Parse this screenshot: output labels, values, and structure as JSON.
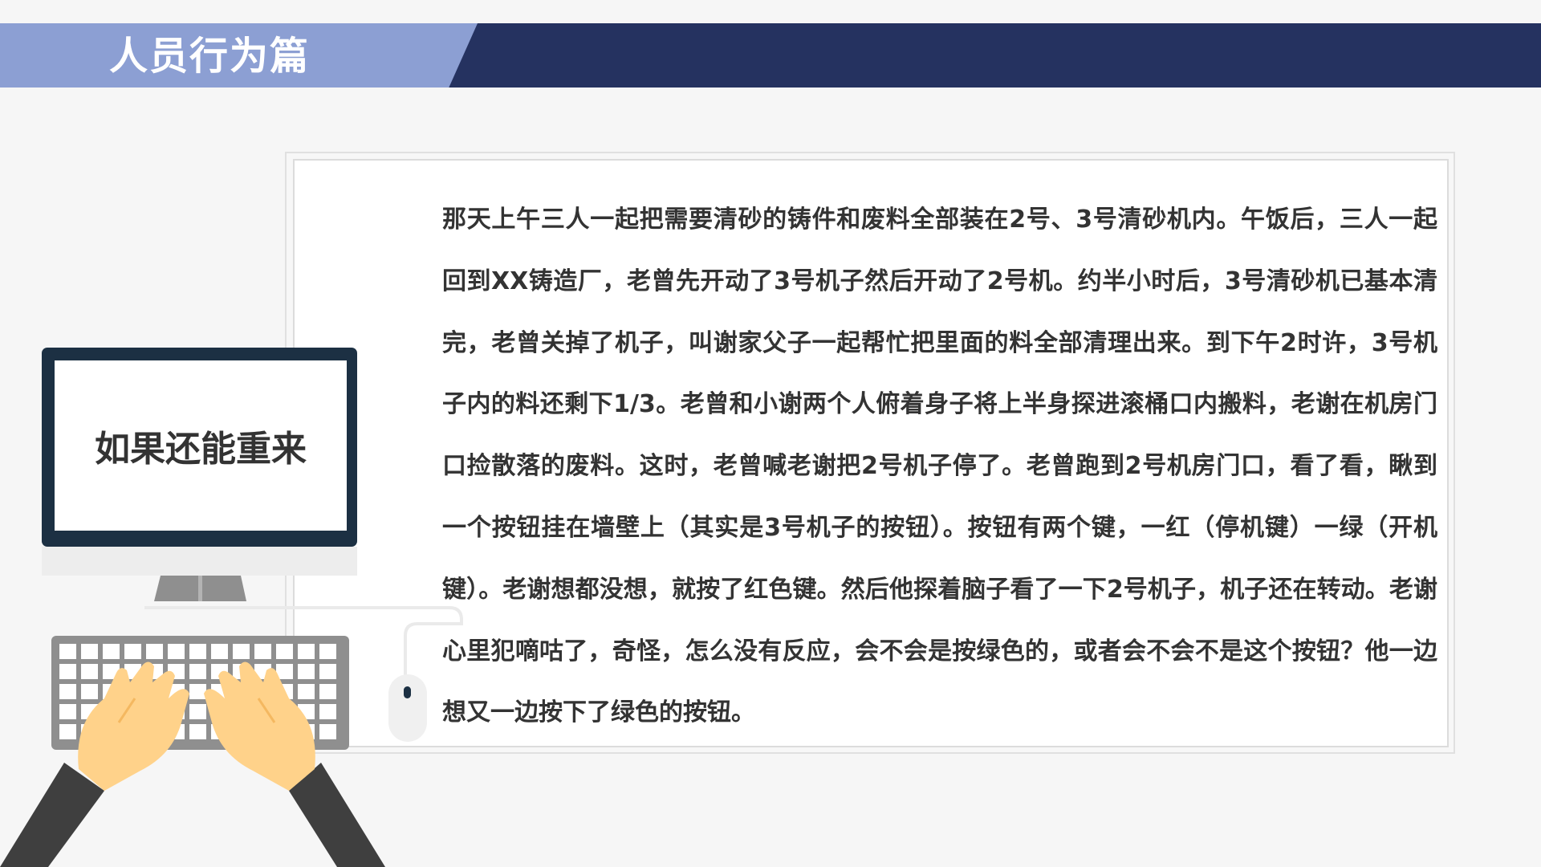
{
  "header": {
    "title": "人员行为篇"
  },
  "monitor": {
    "screen_text": "如果还能重来"
  },
  "story": {
    "text": "那天上午三人一起把需要清砂的铸件和废料全部装在2号、3号清砂机内。午饭后，三人一起回到XX铸造厂，老曾先开动了3号机子然后开动了2号机。约半小时后，3号清砂机已基本清完，老曾关掉了机子，叫谢家父子一起帮忙把里面的料全部清理出来。到下午2时许，3号机子内的料还剩下1/3。老曾和小谢两个人俯着身子将上半身探进滚桶口内搬料，老谢在机房门口捡散落的废料。这时，老曾喊老谢把2号机子停了。老曾跑到2号机房门口，看了看，瞅到一个按钮挂在墙壁上（其实是3号机子的按钮）。按钮有两个键，一红（停机键）一绿（开机键）。老谢想都没想，就按了红色键。然后他探着脑子看了一下2号机子，机子还在转动。老谢心里犯嘀咕了，奇怪，怎么没有反应，会不会是按绿色的，或者会不会不是这个按钮？他一边想又一边按下了绿色的按钮。"
  },
  "colors": {
    "header_dark": "#253260",
    "header_light": "#8c9fd3",
    "monitor_bezel": "#1c3043",
    "skin": "#ffd28a",
    "sleeve": "#3f3f3f"
  },
  "icons": [
    "monitor-icon",
    "keyboard-icon",
    "mouse-icon",
    "hands-icon"
  ]
}
